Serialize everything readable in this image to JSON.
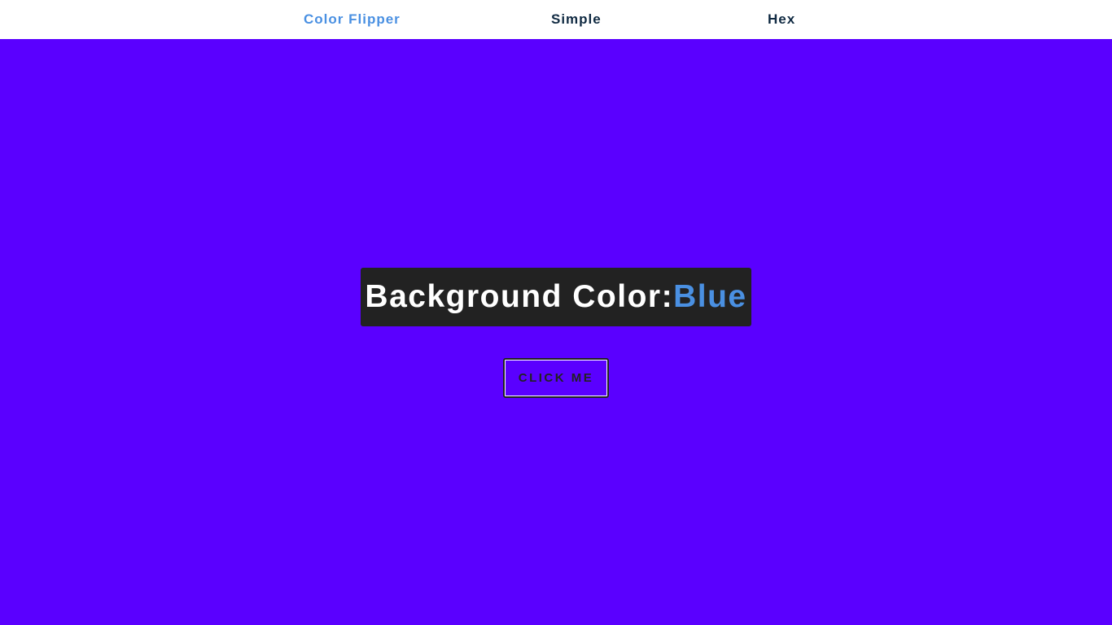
{
  "navbar": {
    "brand": "Color Flipper",
    "links": [
      "Simple",
      "Hex"
    ]
  },
  "main": {
    "label": "Background Color:",
    "color_name": "Blue",
    "button_label": "CLICK ME"
  },
  "colors": {
    "page_background": "#5a00ff",
    "navbar_background": "#ffffff",
    "brand_accent": "#4a90e2",
    "nav_link_text": "#102a42",
    "box_background": "#222222",
    "box_text": "#ffffff",
    "button_text": "#222222"
  }
}
